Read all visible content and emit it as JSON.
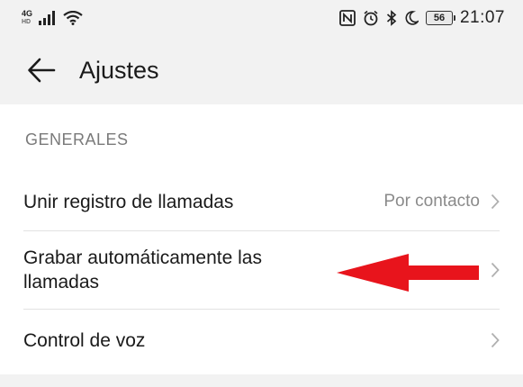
{
  "status_bar": {
    "network_top": "4G",
    "network_bottom": "HD",
    "battery": "56",
    "time": "21:07",
    "icons": [
      "signal-icon",
      "wifi-icon",
      "nfc-icon",
      "alarm-icon",
      "bluetooth-icon",
      "moon-icon",
      "battery-icon"
    ]
  },
  "header": {
    "title": "Ajustes"
  },
  "section": {
    "title": "GENERALES",
    "items": [
      {
        "label": "Unir registro de llamadas",
        "value": "Por contacto"
      },
      {
        "label": "Grabar automáticamente las llamadas",
        "value": ""
      },
      {
        "label": "Control de voz",
        "value": ""
      }
    ]
  },
  "colors": {
    "background": "#f2f2f2",
    "panel": "#ffffff",
    "secondary_text": "#8a8a8a",
    "annotation_arrow": "#e8141c"
  }
}
